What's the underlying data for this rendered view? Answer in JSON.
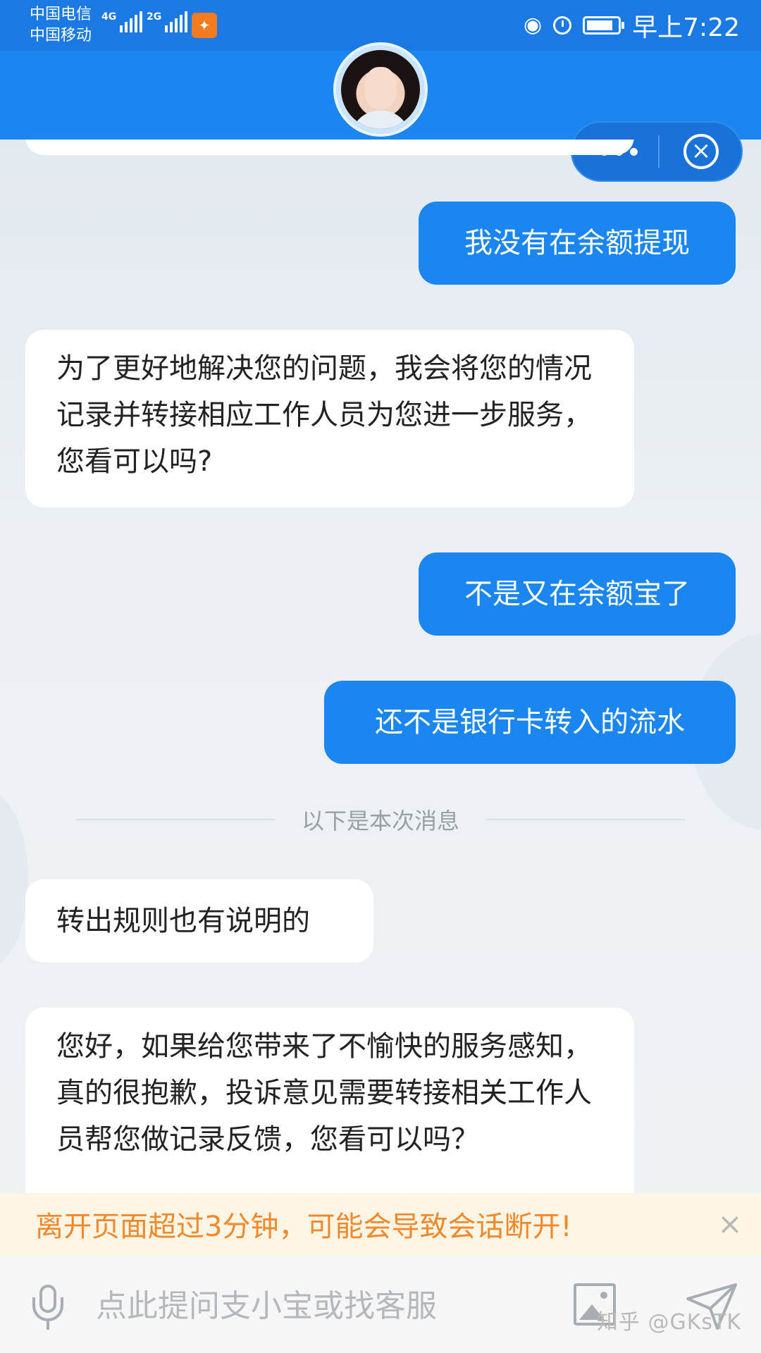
{
  "status_bar": {
    "carrier_1": "中国电信",
    "carrier_2": "中国移动",
    "net_1": "4G",
    "net_2": "2G",
    "time": "早上7:22"
  },
  "header": {
    "capsule_menu": "•••"
  },
  "messages": [
    {
      "side": "out",
      "text": "我没有在余额提现"
    },
    {
      "side": "in",
      "text": "为了更好地解决您的问题，我会将您的情况记录并转接相应工作人员为您进一步服务，您看可以吗?"
    },
    {
      "side": "out",
      "text": "不是又在余额宝了"
    },
    {
      "side": "out",
      "text": "还不是银行卡转入的流水"
    },
    {
      "side": "in",
      "text": "转出规则也有说明的"
    },
    {
      "side": "in",
      "text": "您好，如果给您带来了不愉快的服务感知，真的很抱歉，投诉意见需要转接相关工作人员帮您做记录反馈，您看可以吗？"
    }
  ],
  "separator": "以下是本次消息",
  "warning": {
    "text": "离开页面超过3分钟，可能会导致会话断开!"
  },
  "input": {
    "placeholder": "点此提问支小宝或找客服"
  },
  "watermark": "知乎 @GKsTK",
  "colors": {
    "brand_blue": "#1b86ef",
    "status_blue": "#1b79e4",
    "warning_text": "#f0882c",
    "warning_bg": "#fdf5e3"
  }
}
